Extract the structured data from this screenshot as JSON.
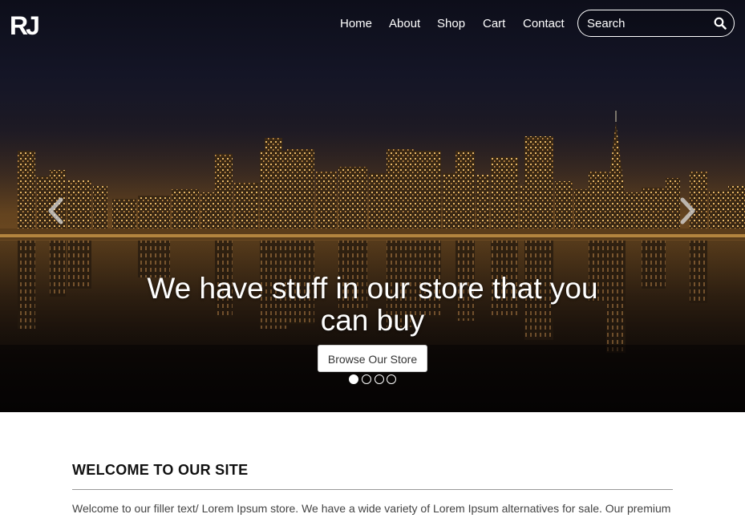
{
  "brand": {
    "logo_text": "RJ"
  },
  "nav": {
    "links": [
      {
        "label": "Home"
      },
      {
        "label": "About"
      },
      {
        "label": "Shop"
      },
      {
        "label": "Cart"
      },
      {
        "label": "Contact"
      }
    ],
    "search": {
      "placeholder": "Search",
      "icon": "search-icon"
    }
  },
  "hero": {
    "headline": "We have stuff in our store that you can buy",
    "cta_label": "Browse Our Store",
    "slides_count": 4,
    "active_slide": 1,
    "prev_icon": "chevron-left-icon",
    "next_icon": "chevron-right-icon"
  },
  "welcome": {
    "title": "WELCOME TO OUR SITE",
    "text": "Welcome to our filler text/ Lorem Ipsum store. We have a wide variety of Lorem Ipsum alternatives for sale. Our premium"
  },
  "colors": {
    "text_light": "#ffffff",
    "heading_dark": "#111111",
    "body_text": "#444444"
  }
}
